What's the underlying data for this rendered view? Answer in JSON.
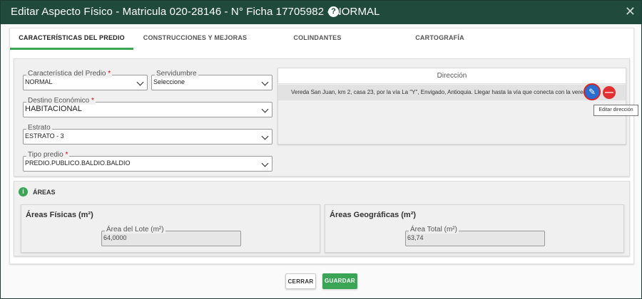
{
  "dialog": {
    "title": "Editar Aspecto Físico - Matricula 020-28146 - N° Ficha 17705982 - NORMAL",
    "help_icon": "help-icon",
    "close_icon": "close-icon"
  },
  "tabs": [
    {
      "label": "CARACTERÍSTICAS DEL PREDIO",
      "active": true
    },
    {
      "label": "CONSTRUCCIONES Y MEJORAS",
      "active": false
    },
    {
      "label": "COLINDANTES",
      "active": false
    },
    {
      "label": "CARTOGRAFÍA",
      "active": false
    }
  ],
  "form": {
    "caracteristica": {
      "label": "Característica del Predio",
      "required_mark": "*",
      "value": "NORMAL"
    },
    "servidumbre": {
      "label": "Servidumbre",
      "value": "Seleccione"
    },
    "destino": {
      "label": "Destino Económico",
      "required_mark": "*",
      "value": "HABITACIONAL"
    },
    "estrato": {
      "label": "Estrato",
      "value": "ESTRATO - 3"
    },
    "tipo_predio": {
      "label": "Tipo predio",
      "required_mark": "*",
      "value": "PREDIO.PUBLICO.BALDIO.BALDIO"
    }
  },
  "direccion": {
    "header": "Dirección",
    "text": "Vereda San Juan, km 2, casa 23, por la vía La \"Y\", Envigado, Antioquia. Llegar hasta la vía que conecta con la vereda",
    "edit_tooltip": "Editar dirección",
    "edit_icon": "pencil-icon",
    "remove_icon": "minus-icon",
    "remove_symbol": "—",
    "edit_symbol": "✎"
  },
  "areas": {
    "title": "ÁREAS",
    "info_symbol": "i",
    "fisicas": {
      "title": "Áreas Físicas (m²)",
      "field_label": "Área del Lote (m²)",
      "value": "64,0000"
    },
    "geograficas": {
      "title": "Áreas Geográficas (m²)",
      "field_label": "Área Total (m²)",
      "value": "63,74"
    }
  },
  "footer": {
    "close_label": "CERRAR",
    "save_label": "GUARDAR"
  },
  "colors": {
    "titlebar": "#1f4a3c",
    "accent_green": "#3aa655",
    "edit_blue": "#2a6dd0",
    "remove_red": "#e03030"
  }
}
